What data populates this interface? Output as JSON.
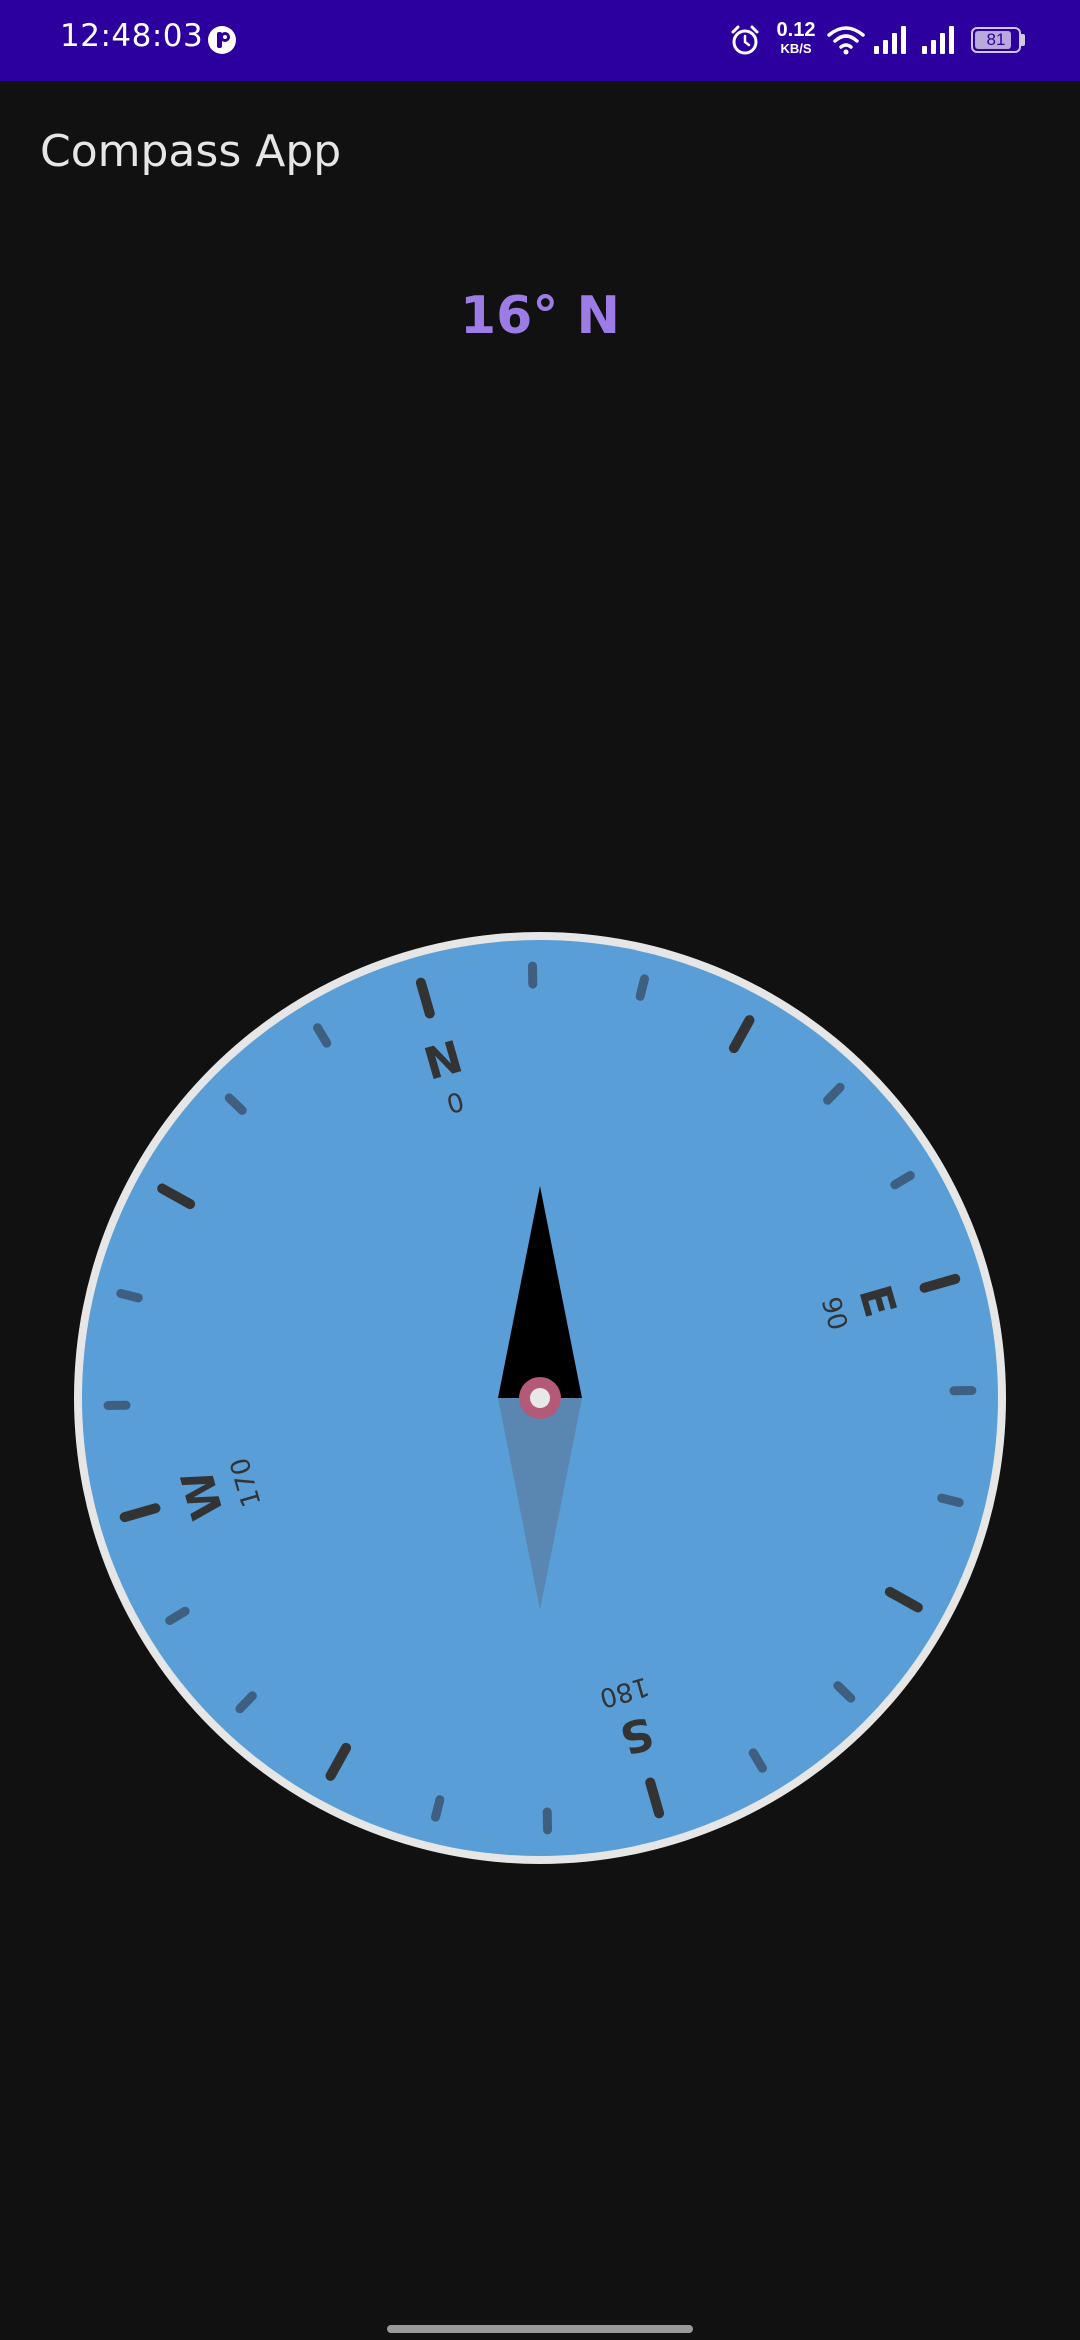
{
  "status_bar": {
    "time": "12:48:03",
    "net_speed_value": "0.12",
    "net_speed_unit": "KB/S",
    "battery_level": "81",
    "icons": [
      "notification-app-icon",
      "alarm-icon",
      "wifi-icon",
      "signal-icon",
      "signal-icon",
      "battery-icon"
    ]
  },
  "app_bar": {
    "title": "Compass App"
  },
  "reading": {
    "text": "16° N",
    "degrees": 16
  },
  "compass": {
    "dial_rotation_deg": -16,
    "cardinals": [
      {
        "letter": "N",
        "degree_label": "0"
      },
      {
        "letter": "E",
        "degree_label": "90"
      },
      {
        "letter": "S",
        "degree_label": "180"
      },
      {
        "letter": "W",
        "degree_label": "170"
      }
    ],
    "colors": {
      "face": "#5a9ed8",
      "ring": "#e6e6e6",
      "major_tick": "#333333",
      "minor_tick": "#3f5f80",
      "needle_north": "#000000",
      "needle_south": "#5a86b2",
      "pivot_ring": "#b25a78",
      "pivot_center": "#e8e8e8"
    }
  },
  "theme": {
    "status_bar_color": "#2c009e",
    "background": "#111111",
    "accent": "#9d7ce6"
  }
}
